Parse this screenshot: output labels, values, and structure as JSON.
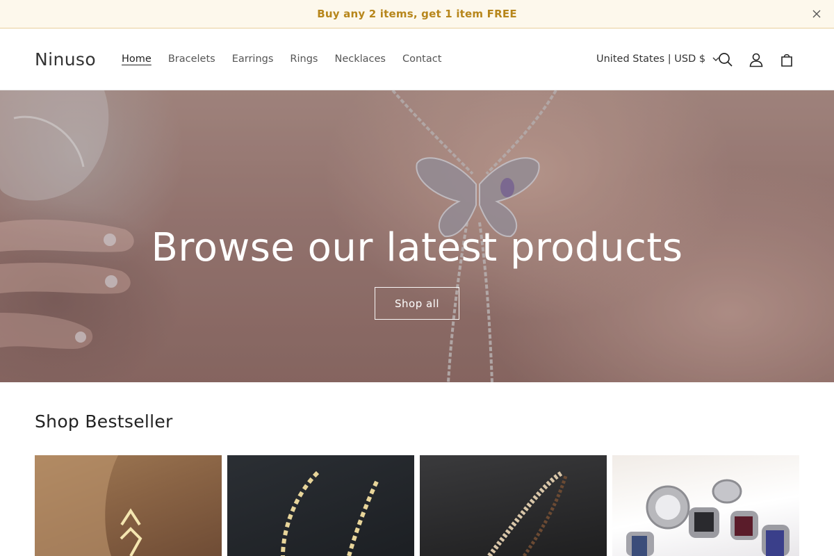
{
  "announcement": {
    "text": "Buy any 2 items, get 1 item FREE",
    "close_icon": "close-icon"
  },
  "header": {
    "logo": "Ninuso",
    "nav": [
      {
        "label": "Home",
        "active": true
      },
      {
        "label": "Bracelets",
        "active": false
      },
      {
        "label": "Earrings",
        "active": false
      },
      {
        "label": "Rings",
        "active": false
      },
      {
        "label": "Necklaces",
        "active": false
      },
      {
        "label": "Contact",
        "active": false
      }
    ],
    "country_selector": "United States | USD $",
    "icons": [
      "search-icon",
      "account-icon",
      "cart-icon"
    ]
  },
  "hero": {
    "title": "Browse our latest products",
    "button_label": "Shop all"
  },
  "bestseller": {
    "title": "Shop Bestseller",
    "products": [
      {
        "image": "earring-product-image"
      },
      {
        "image": "crystal-bracelet-product-image"
      },
      {
        "image": "bead-necklace-product-image"
      },
      {
        "image": "steel-ring-product-image"
      }
    ]
  },
  "colors": {
    "announce_bg": "#fdf8ec",
    "announce_text": "#b7861b",
    "text": "#222222"
  }
}
